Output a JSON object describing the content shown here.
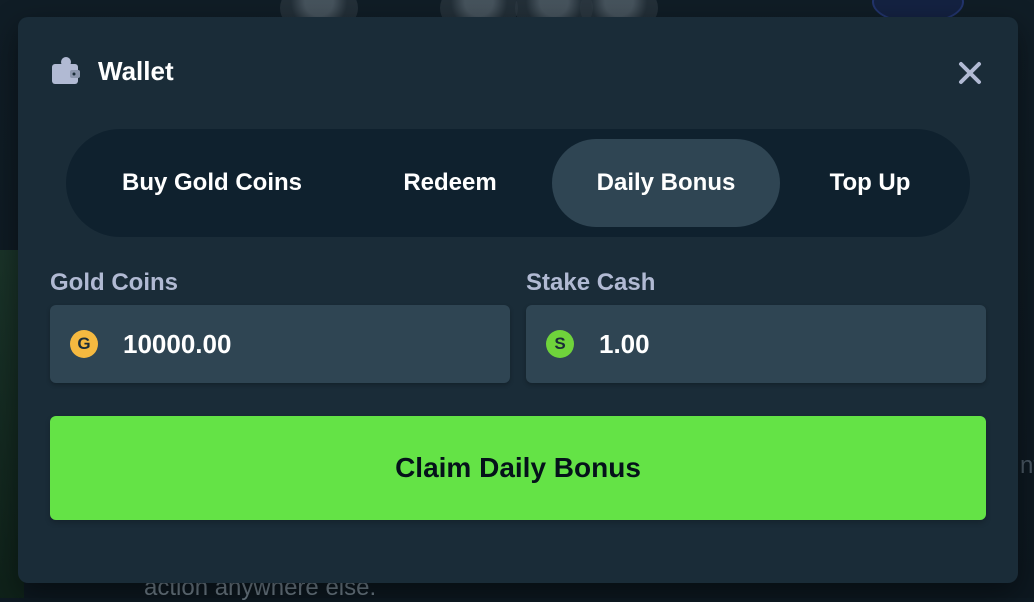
{
  "wallet": {
    "title": "Wallet",
    "icon": "wallet-icon",
    "close_icon": "close-icon"
  },
  "tabs": [
    {
      "label": "Buy Gold Coins",
      "active": false
    },
    {
      "label": "Redeem",
      "active": false
    },
    {
      "label": "Daily Bonus",
      "active": true
    },
    {
      "label": "Top Up",
      "active": false
    }
  ],
  "balances": {
    "gold": {
      "label": "Gold Coins",
      "symbol": "G",
      "value": "10000.00",
      "color": "#f5b940"
    },
    "stake_cash": {
      "label": "Stake Cash",
      "symbol": "S",
      "value": "1.00",
      "color": "#6fd33b"
    }
  },
  "claim_button": {
    "label": "Claim Daily Bonus",
    "color": "#64e346"
  },
  "background": {
    "text_fragment": "action anywhere else.",
    "right_fragment": "nf"
  }
}
